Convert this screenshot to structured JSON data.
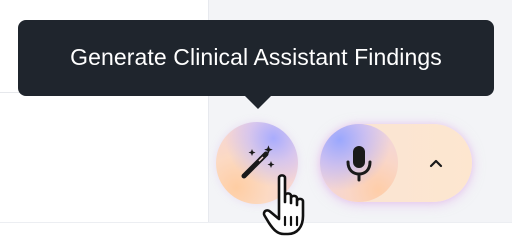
{
  "tooltip": {
    "text": "Generate Clinical Assistant Findings"
  },
  "buttons": {
    "generate_findings": {
      "icon": "magic-wand-icon"
    },
    "microphone": {
      "icon": "microphone-icon"
    },
    "expand": {
      "icon": "chevron-up-icon"
    }
  },
  "cursor": {
    "icon": "hand-pointer-icon"
  },
  "colors": {
    "tooltip_bg": "#1f252d",
    "tooltip_text": "#ffffff",
    "panel_bg": "#f3f4f7",
    "icon_color": "#1a1a1a"
  }
}
